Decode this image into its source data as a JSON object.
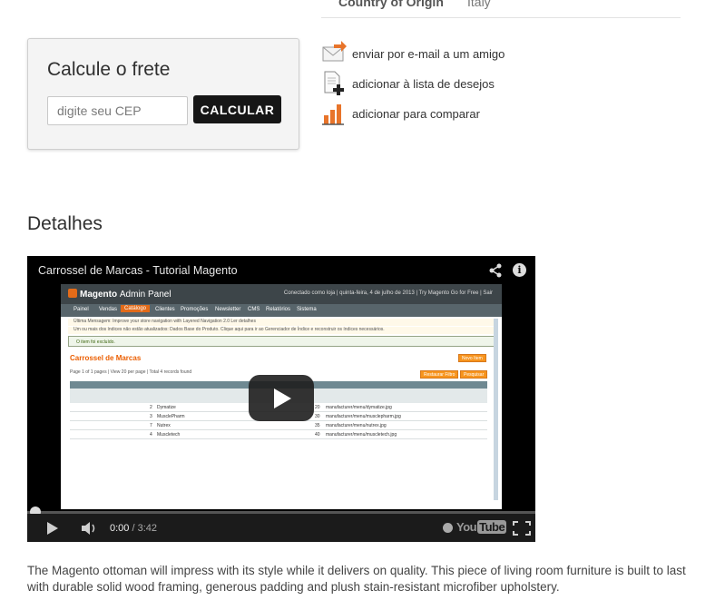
{
  "attributes": {
    "label": "Country of Origin",
    "value": "Italy"
  },
  "shipping": {
    "title": "Calcule o frete",
    "input_placeholder": "digite seu CEP",
    "button_label": "CALCULAR"
  },
  "actions": [
    {
      "icon": "email-icon",
      "label": "enviar por e-mail a um amigo"
    },
    {
      "icon": "wishlist-add-icon",
      "label": "adicionar à lista de desejos"
    },
    {
      "icon": "compare-chart-icon",
      "label": "adicionar para comparar"
    }
  ],
  "details": {
    "title": "Detalhes",
    "description": "The Magento ottoman will impress with its style while it delivers on quality. This piece of living room furniture is built to last with durable solid wood framing, generous padding and plush stain-resistant microfiber upholstery."
  },
  "video": {
    "title": "Carrossel de Marcas - Tutorial Magento",
    "current_time": "0:00",
    "duration": "/ 3:42",
    "progress": 0,
    "brand": "You",
    "brand_tube": "Tube",
    "thumbnail": {
      "logo": "Magento",
      "logo_sub": "Admin Panel",
      "top_right": "Conectado como loja  |  quinta-feira, 4 de julho de 2013  |  Try Magento Go for Free  |  Sair",
      "nav": [
        "Painel",
        "Vendas",
        "Catálogo",
        "Clientes",
        "Promoções",
        "Newsletter",
        "CMS",
        "Relatórios",
        "Sistema"
      ],
      "alert1": "Última Mensagem: Improve your store navigation with Layered Navigation 2.0  Ler detalhes",
      "alert2": "Um ou mais dos índices não estão atualizados: Dados Base do Produto. Clique aqui para ir ao Gerenciador de Índice e reconstruir os índices necessários.",
      "success": "O item foi excluído.",
      "heading": "Carrossel de Marcas",
      "new_button": "Novo Item",
      "reset_button": "Restaurar Filtro",
      "search_button": "Pesquisar",
      "pager": "Page  1  of 1 pages  |  View  20  per page  |  Total 4 records found",
      "rows": [
        {
          "id": "2",
          "name": "Dymatize",
          "pos": "20",
          "logo": "manufacturer/menu/dymatize.jpg"
        },
        {
          "id": "3",
          "name": "MusclePharm",
          "pos": "30",
          "logo": "manufacturer/menu/musclepharm.jpg"
        },
        {
          "id": "7",
          "name": "Nutrex",
          "pos": "35",
          "logo": "manufacturer/menu/nutrex.jpg"
        },
        {
          "id": "4",
          "name": "Muscletech",
          "pos": "40",
          "logo": "manufacturer/menu/muscletech.jpg"
        }
      ]
    }
  }
}
